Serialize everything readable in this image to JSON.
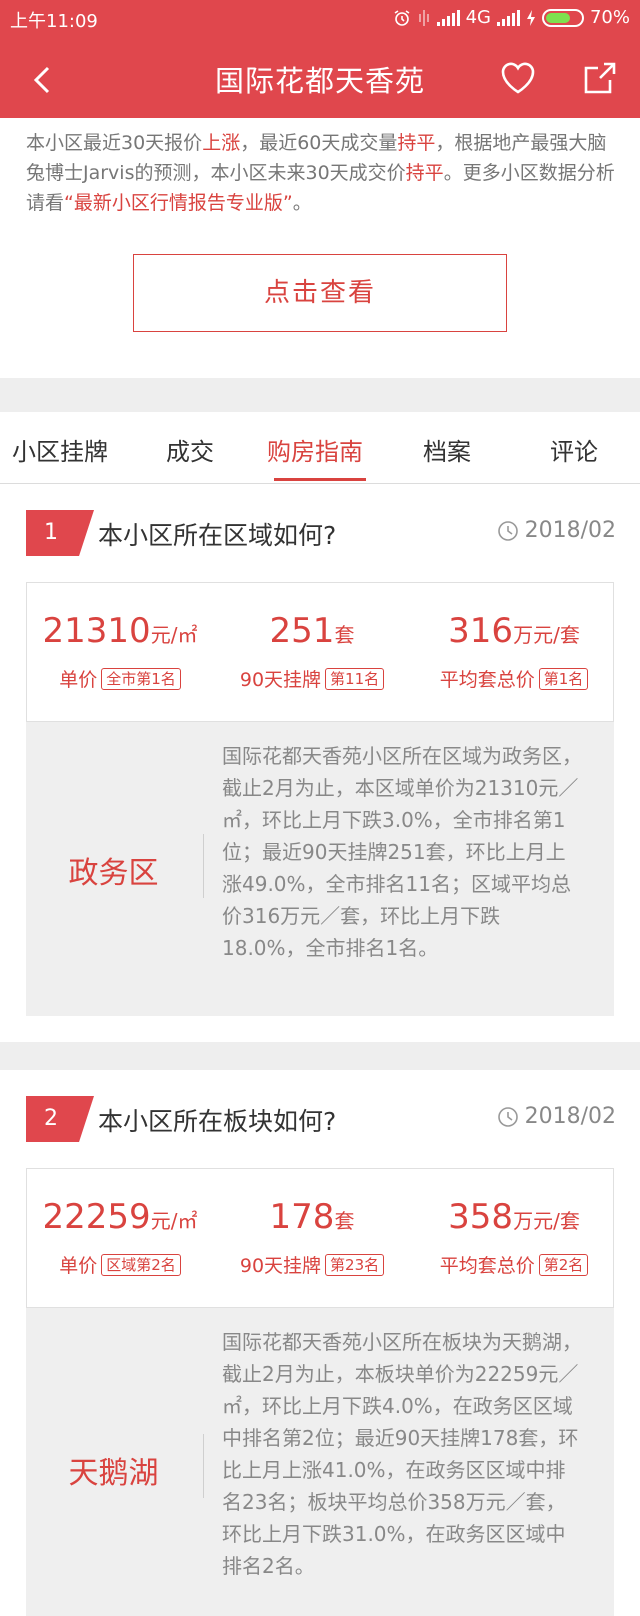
{
  "status_bar": {
    "time": "上午11:09",
    "network": "4G",
    "battery": "70%",
    "battery_level": 0.7
  },
  "nav": {
    "title": "国际花都天香苑"
  },
  "intro": {
    "t1": "本小区最近30天报价",
    "h1": "上涨",
    "t2": "，最近60天成交量",
    "h2": "持平",
    "t3": "，根据地产最强大脑兔博士Jarvis的预测，本小区未来30天成交价",
    "h3": "持平",
    "t4": "。更多小区数据分析请看",
    "h4": "“最新小区行情报告专业版”",
    "t5": "。"
  },
  "cta": {
    "label": "点击查看"
  },
  "tabs": [
    {
      "label": "小区挂牌"
    },
    {
      "label": "成交"
    },
    {
      "label": "购房指南",
      "active": true
    },
    {
      "label": "档案"
    },
    {
      "label": "评论"
    }
  ],
  "sections": [
    {
      "index": "1",
      "title": "本小区所在区域如何?",
      "date": "2018/02",
      "stats": [
        {
          "value": "21310",
          "unit": "元/㎡",
          "label": "单价",
          "rank": "全市第1名"
        },
        {
          "value": "251",
          "unit": "套",
          "label": "90天挂牌",
          "rank": "第11名"
        },
        {
          "value": "316",
          "unit": "万元/套",
          "label": "平均套总价",
          "rank": "第1名"
        }
      ],
      "area_name": "政务区",
      "description": "国际花都天香苑小区所在区域为政务区，截止2月为止，本区域单价为21310元／㎡，环比上月下跌3.0%，全市排名第1位；最近90天挂牌251套，环比上月上涨49.0%，全市排名11名；区域平均总价316万元／套，环比上月下跌18.0%，全市排名1名。"
    },
    {
      "index": "2",
      "title": "本小区所在板块如何?",
      "date": "2018/02",
      "stats": [
        {
          "value": "22259",
          "unit": "元/㎡",
          "label": "单价",
          "rank": "区域第2名"
        },
        {
          "value": "178",
          "unit": "套",
          "label": "90天挂牌",
          "rank": "第23名"
        },
        {
          "value": "358",
          "unit": "万元/套",
          "label": "平均套总价",
          "rank": "第2名"
        }
      ],
      "area_name": "天鹅湖",
      "description": "国际花都天香苑小区所在板块为天鹅湖，截止2月为止，本板块单价为22259元／㎡，环比上月下跌4.0%，在政务区区域中排名第2位；最近90天挂牌178套，环比上月上涨41.0%，在政务区区域中排名23名；板块平均总价358万元／套，环比上月下跌31.0%，在政务区区域中排名2名。"
    }
  ],
  "colors": {
    "brand": "#e0474d",
    "accent": "#d9433f"
  }
}
